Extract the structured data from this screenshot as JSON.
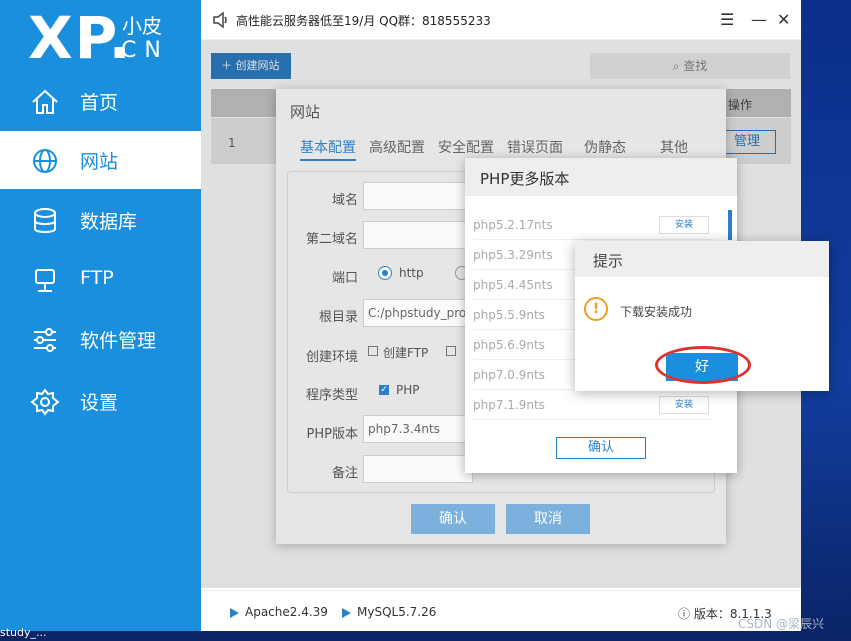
{
  "colors": {
    "brand": "#1a8fdd",
    "accent": "#2d7fc7",
    "warning": "#f0a020",
    "highlight_ring": "#e03030"
  },
  "logo": {
    "main": "XP.",
    "small": "小皮",
    "cn": "CN"
  },
  "sidebar": {
    "items": [
      {
        "label": "首页",
        "icon": "home-icon"
      },
      {
        "label": "网站",
        "icon": "globe-icon",
        "active": true
      },
      {
        "label": "数据库",
        "icon": "database-icon"
      },
      {
        "label": "FTP",
        "icon": "ftp-icon"
      },
      {
        "label": "软件管理",
        "icon": "sliders-icon"
      },
      {
        "label": "设置",
        "icon": "gear-icon"
      }
    ]
  },
  "topbar": {
    "notice": "高性能云服务器低至19/月  QQ群：818555233"
  },
  "toolbar": {
    "create_label": "创建网站",
    "search_label": "查找"
  },
  "table": {
    "header_action": "操作",
    "row_index": "1",
    "row_action": "管理"
  },
  "website_dialog": {
    "title": "网站",
    "tabs": [
      "基本配置",
      "高级配置",
      "安全配置",
      "错误页面",
      "伪静态",
      "其他"
    ],
    "fields": {
      "domain_label": "域名",
      "second_domain_label": "第二域名",
      "port_label": "端口",
      "port_value": "http",
      "root_label": "根目录",
      "root_value": "C:/phpstudy_pro/",
      "env_label": "创建环境",
      "env_option": "创建FTP",
      "type_label": "程序类型",
      "type_value": "PHP",
      "php_label": "PHP版本",
      "php_value": "php7.3.4nts",
      "note_label": "备注"
    },
    "confirm_label": "确认",
    "cancel_label": "取消"
  },
  "php_dialog": {
    "title": "PHP更多版本",
    "versions": [
      "php5.2.17nts",
      "php5.3.29nts",
      "php5.4.45nts",
      "php5.5.9nts",
      "php5.6.9nts",
      "php7.0.9nts",
      "php7.1.9nts"
    ],
    "install_label": "安装",
    "confirm_label": "确认"
  },
  "tip_dialog": {
    "title": "提示",
    "icon_glyph": "!",
    "message": "下载安装成功",
    "ok_label": "好"
  },
  "statusbar": {
    "apache": "Apache2.4.39",
    "mysql": "MySQL5.7.26",
    "version": "版本：8.1.1.3"
  },
  "taskbar": {
    "text": "study_..."
  },
  "watermark": "CSDN @梁辰兴"
}
